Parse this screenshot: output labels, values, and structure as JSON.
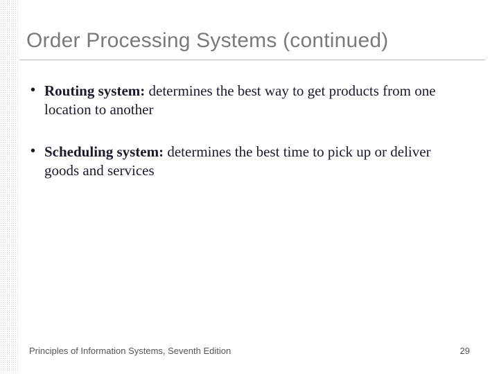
{
  "title": "Order Processing Systems (continued)",
  "bullets": [
    {
      "term": "Routing system:",
      "text": " determines the best way to get products from one location to another"
    },
    {
      "term": "Scheduling system:",
      "text": " determines the best time to pick up or deliver goods and services"
    }
  ],
  "footer": {
    "source": "Principles of Information Systems, Seventh Edition",
    "page": "29"
  }
}
